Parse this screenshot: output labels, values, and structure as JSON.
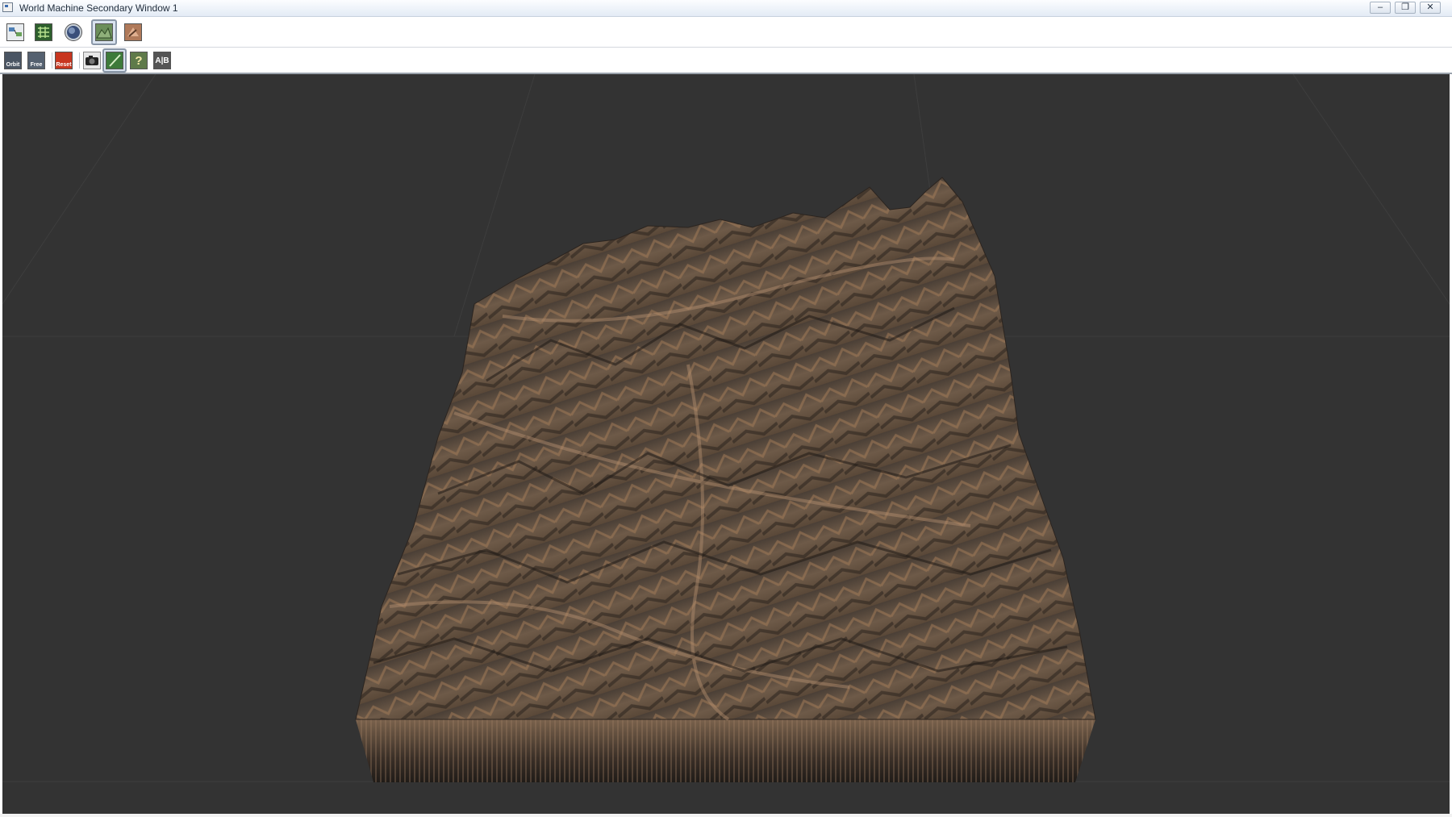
{
  "window": {
    "title": "World Machine Secondary Window 1",
    "controls": {
      "minimize_icon": "minimize-icon",
      "restore_icon": "restore-icon",
      "close_icon": "close-icon"
    }
  },
  "toolbar_top": {
    "buttons": [
      {
        "icon": "device-view-icon"
      },
      {
        "icon": "layout-view-icon"
      },
      {
        "icon": "globe-view-icon"
      },
      {
        "icon": "3d-preview-icon",
        "active": true
      },
      {
        "icon": "texture-view-icon"
      }
    ]
  },
  "toolbar_bottom": {
    "buttons": [
      {
        "icon": "orbit-icon",
        "label": "Orbit"
      },
      {
        "icon": "free-camera-icon",
        "label": "Free"
      },
      {
        "icon": "reset-camera-icon",
        "label": "Reset"
      },
      {
        "icon": "camera-icon"
      },
      {
        "icon": "wireframe-toggle-icon",
        "active": true
      },
      {
        "icon": "help-icon"
      },
      {
        "icon": "ab-compare-icon",
        "label": "A|B"
      }
    ]
  },
  "viewport": {
    "content": "3d-terrain-preview",
    "background_color": "#333333",
    "terrain_colors": [
      "#6e5a48",
      "#a07a58",
      "#3a2f27",
      "#b59070"
    ]
  }
}
